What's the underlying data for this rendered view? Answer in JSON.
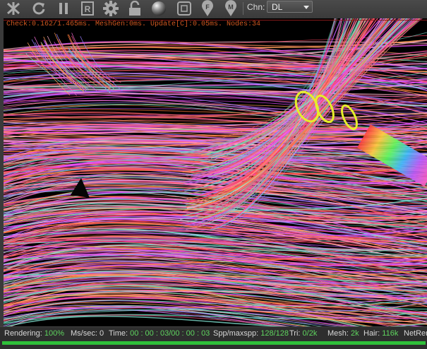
{
  "toolbar": {
    "icons": [
      "tone-map-icon",
      "refresh-icon",
      "pause-icon",
      "region-render-icon",
      "settings-icon",
      "lock-icon",
      "material-ball-icon",
      "clay-mode-icon",
      "focus-pick-icon",
      "material-pick-icon"
    ],
    "channel_label": "Chn:",
    "channel_value": "DL"
  },
  "viewport": {
    "stats_overlay": "Check:0.162/1.465ms. MeshGen:0ms. Update[C]:0.05ms. Nodes:34"
  },
  "statusbar": {
    "rendering_label": "Rendering:",
    "rendering_value": "100%",
    "ms_label": "Ms/sec:",
    "ms_value": "0",
    "time_label": "Time:",
    "time_value": "00 : 00 : 03/00 : 00 : 03",
    "spp_label": "Spp/maxspp:",
    "spp_value": "128/128",
    "tri_label": "Tri:",
    "tri_value": "0/2k",
    "mesh_label": "Mesh:",
    "mesh_value": "2k",
    "hair_label": "Hair:",
    "hair_value": "116k",
    "net_label": "NetRen",
    "progress": 1.0
  },
  "colors": {
    "overlay_text": "#d2591f",
    "progress": "#2fbf3a",
    "value_text": "#5fd45f"
  }
}
